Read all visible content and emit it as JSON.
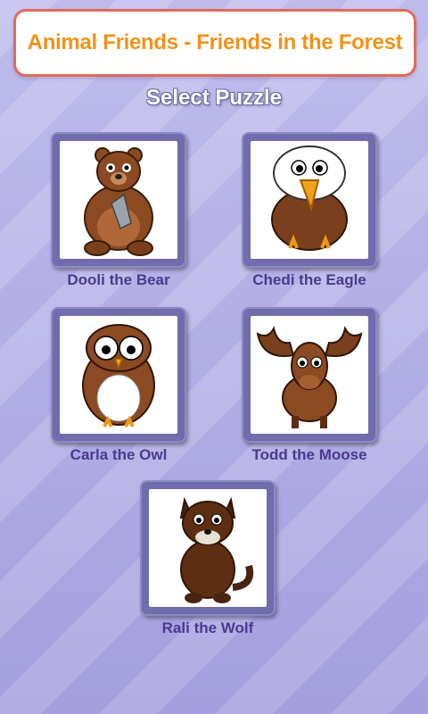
{
  "header": {
    "title": "Animal Friends - Friends in the Forest"
  },
  "page": {
    "subtitle": "Select Puzzle"
  },
  "puzzles": [
    {
      "label": "Dooli the Bear",
      "icon": "bear-icon"
    },
    {
      "label": "Chedi the Eagle",
      "icon": "eagle-icon"
    },
    {
      "label": "Carla the Owl",
      "icon": "owl-icon"
    },
    {
      "label": "Todd the Moose",
      "icon": "moose-icon"
    },
    {
      "label": "Rali the Wolf",
      "icon": "wolf-icon"
    }
  ],
  "colors": {
    "title_text": "#f29218",
    "title_border": "#e26a5b",
    "label_text": "#4b3a8e",
    "frame": "#706cad",
    "background": "#b9b6e6"
  }
}
